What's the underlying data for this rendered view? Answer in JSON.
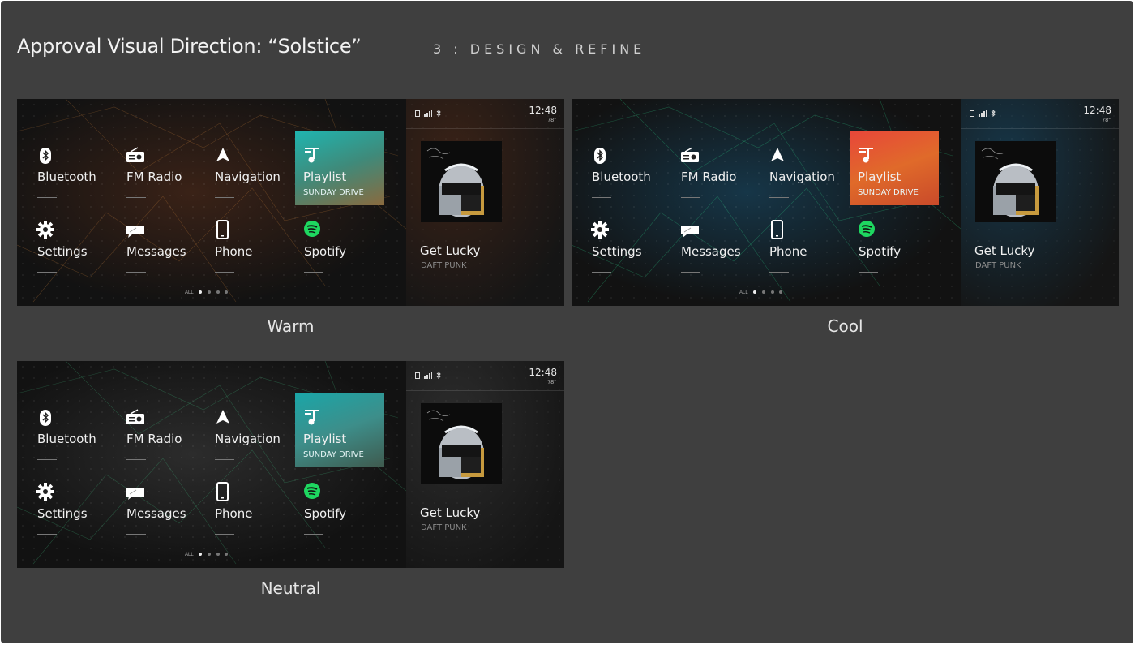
{
  "header": {
    "title": "Approval Visual Direction: “Solstice”",
    "section": "3 : DESIGN & REFINE"
  },
  "variants": [
    {
      "label": "Warm",
      "accent": "#c07a3a",
      "bg_tint": "#3a2217",
      "playlist_gradient": [
        "#1fb5b0",
        "#3f8a7a",
        "#8a6a3e"
      ]
    },
    {
      "label": "Cool",
      "accent": "#2fd08a",
      "bg_tint": "#163648",
      "playlist_gradient": [
        "#e8463a",
        "#e06a2a",
        "#c94a2a"
      ]
    },
    {
      "label": "Neutral",
      "accent": "#3fb47a",
      "bg_tint": "#2c2c2c",
      "playlist_gradient": [
        "#1aa6a8",
        "#3d8e8a",
        "#3f5a4e"
      ]
    }
  ],
  "menu": {
    "bluetooth": "Bluetooth",
    "fm_radio": "FM Radio",
    "navigation": "Navigation",
    "playlist": "Playlist",
    "playlist_sub": "SUNDAY DRIVE",
    "settings": "Settings",
    "messages": "Messages",
    "phone": "Phone",
    "spotify": "Spotify"
  },
  "pager": {
    "all": "ALL",
    "page_count": 4,
    "active_page": 1
  },
  "status": {
    "time": "12:48",
    "temperature": "78°"
  },
  "now_playing": {
    "title": "Get Lucky",
    "artist": "DAFT PUNK"
  },
  "icons": [
    "bluetooth-icon",
    "radio-icon",
    "navigation-arrow-icon",
    "music-note-icon",
    "gear-icon",
    "message-icon",
    "phone-icon",
    "spotify-icon",
    "battery-icon",
    "signal-icon"
  ],
  "colors": {
    "spotify_green": "#1ed760",
    "panel_bg": "#3f3f3f"
  }
}
